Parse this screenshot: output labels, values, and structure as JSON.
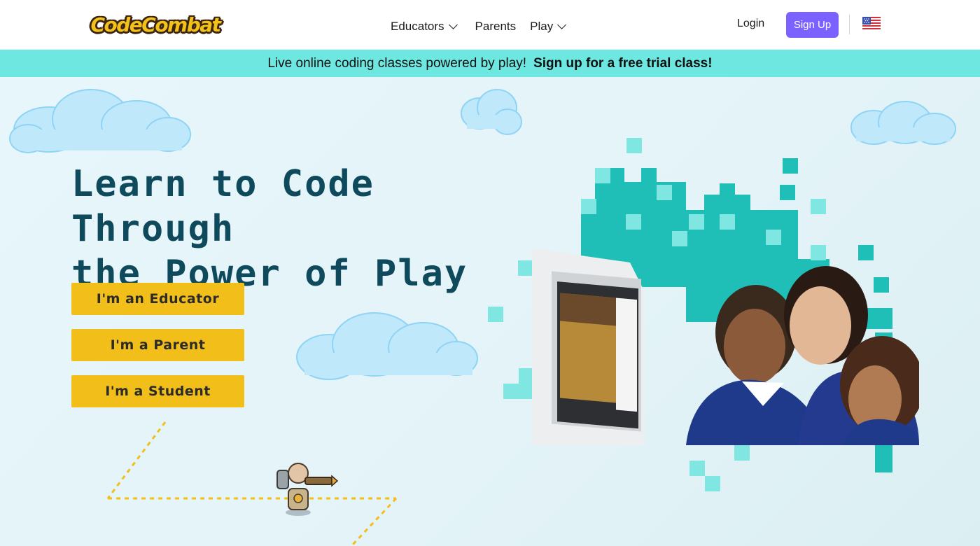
{
  "brand": {
    "logo_text": "CodeCombat"
  },
  "nav": {
    "items": [
      {
        "label": "Educators",
        "has_dropdown": true
      },
      {
        "label": "Parents",
        "has_dropdown": false
      },
      {
        "label": "Play",
        "has_dropdown": true
      }
    ],
    "login_label": "Login",
    "signup_label": "Sign Up",
    "language_icon": "us-flag-icon"
  },
  "promo": {
    "text": "Live online coding classes powered by play!",
    "link_label": "Sign up for a free trial class!"
  },
  "hero": {
    "headline_line1": "Learn to Code Through",
    "headline_line2": "the Power of Play",
    "cta_buttons": [
      {
        "label": "I'm an Educator"
      },
      {
        "label": "I'm a Parent"
      },
      {
        "label": "I'm a Student"
      }
    ]
  },
  "colors": {
    "signup_bg": "#7b61ff",
    "promo_bg": "#6ee7e0",
    "cta_bg": "#f2be1a",
    "headline": "#0e4a5c",
    "pixel_teal": "#1fbfb8",
    "pixel_light": "#7fe6e2"
  }
}
